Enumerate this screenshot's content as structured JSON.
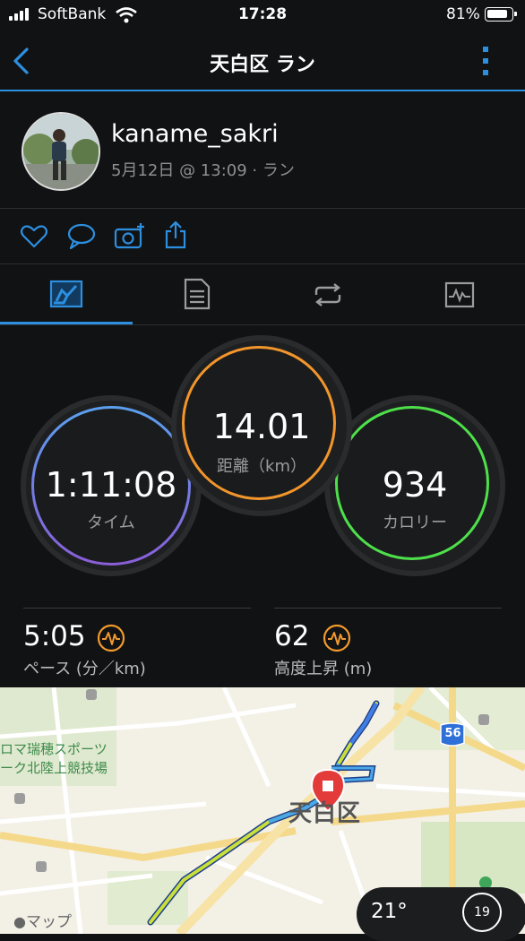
{
  "status_bar": {
    "carrier": "SoftBank",
    "time": "17:28",
    "battery": "81%"
  },
  "nav": {
    "title": "天白区 ラン"
  },
  "profile": {
    "username": "kaname_sakri",
    "subtitle": "5月12日 @ 13:09 · ラン"
  },
  "actions": [
    "heart-icon",
    "comment-icon",
    "add-photo-icon",
    "share-icon"
  ],
  "tabs": [
    "overview-tab",
    "details-tab",
    "laps-tab",
    "charts-tab"
  ],
  "circles": {
    "time": {
      "value": "1:11:08",
      "label": "タイム"
    },
    "distance": {
      "value": "14.01",
      "label": "距離（km）"
    },
    "calories": {
      "value": "934",
      "label": "カロリー"
    }
  },
  "stats": {
    "pace": {
      "value": "5:05",
      "label": "ペース (分／km)"
    },
    "elevation": {
      "value": "62",
      "label": "高度上昇 (m)"
    }
  },
  "map": {
    "place_label": "天白区",
    "poi_label_line1": "ロマ瑞穂スポーツ",
    "poi_label_line2": "ーク北陸上競技場",
    "route_shield": "56",
    "attribution": "マップ"
  },
  "weather": {
    "temperature": "21°",
    "wind": "19"
  },
  "colors": {
    "accent": "#2d8fe0",
    "time_ring": "#6a8fe6",
    "distance_ring": "#f2962b",
    "calories_ring": "#4ee04a",
    "metric_icon": "#f29a2e"
  }
}
